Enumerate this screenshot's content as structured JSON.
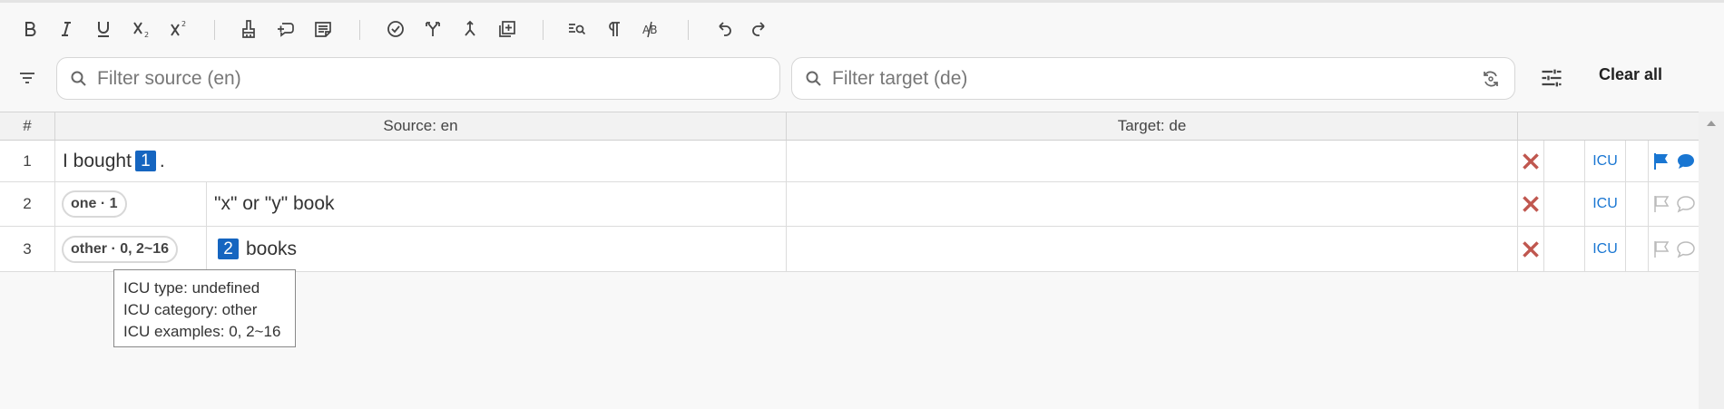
{
  "toolbar": {
    "buttons": [
      "bold",
      "italic",
      "underline",
      "subscript",
      "superscript",
      "clear-format",
      "insert-tag",
      "insert-text",
      "validate",
      "branch",
      "merge",
      "add-segment",
      "find-replace",
      "show-formatting-marks",
      "spellcheck",
      "undo",
      "redo"
    ]
  },
  "filter": {
    "source_placeholder": "Filter source (en)",
    "target_placeholder": "Filter target (de)",
    "clear_all": "Clear all"
  },
  "grid": {
    "headers": {
      "num": "#",
      "source": "Source: en",
      "target": "Target: de"
    },
    "rows": [
      {
        "num": "1",
        "text_before": "I bought",
        "placeholder": "1",
        "text_after": ".",
        "icu": "ICU",
        "flag_active": true,
        "comment_active": true
      },
      {
        "num": "2",
        "pill": "one · 1",
        "text": "\"x\" or \"y\" book",
        "icu": "ICU",
        "flag_active": false,
        "comment_active": false
      },
      {
        "num": "3",
        "pill": "other · 0, 2~16",
        "placeholder": "2",
        "text": "books",
        "icu": "ICU",
        "flag_active": false,
        "comment_active": false
      }
    ]
  },
  "tooltip": {
    "line1": "ICU type: undefined",
    "line2": "ICU category: other",
    "line3": "ICU examples: 0, 2~16"
  },
  "colors": {
    "accent": "#1976d2",
    "placeholder_bg": "#1565c0",
    "delete": "#c0574f"
  }
}
